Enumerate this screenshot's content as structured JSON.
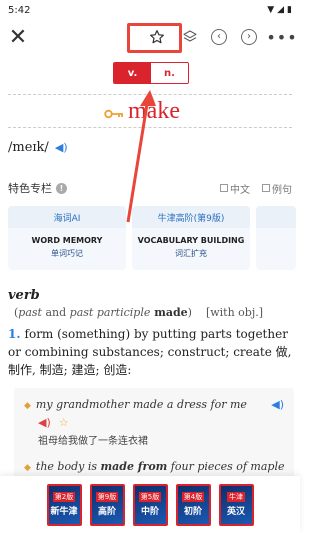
{
  "status_bar": {
    "time": "5:42"
  },
  "toolbar": {
    "close_glyph": "✕",
    "more_glyph": "•••"
  },
  "pos_tabs": [
    "v.",
    "n."
  ],
  "entry": {
    "headword": "make",
    "phonetic": "/meɪk/"
  },
  "features": {
    "title": "特色专栏",
    "toggle_chinese": "中文",
    "toggle_example": "例句",
    "cards": [
      {
        "top": "海词AI",
        "title": "WORD MEMORY",
        "sub": "单词巧记"
      },
      {
        "top": "牛津高阶(第9版)",
        "title": "VOCABULARY BUILDING",
        "sub": "词汇扩充"
      },
      {
        "top": "",
        "title": "",
        "sub": ""
      }
    ]
  },
  "definition": {
    "pos": "verb",
    "grammar_prefix": "(",
    "grammar_italic": "past",
    "grammar_mid": " and ",
    "grammar_italic2": "past participle",
    "grammar_bold": " made",
    "grammar_suffix": ")    [with obj.]",
    "sense_number": "1.",
    "sense_text": "form (something) by putting parts together or combining substances; construct; create 做, 制作, 制造; 建造; 创造:"
  },
  "examples": [
    {
      "text": "my grandmother made a dress for me",
      "translation": "祖母给我做了一条连衣裙"
    },
    {
      "text_prefix": "the body is ",
      "text_bold": "made from",
      "text_suffix": " four pieces of maple"
    }
  ],
  "books": [
    {
      "top": "第2版",
      "main": "新牛津"
    },
    {
      "top": "第9版",
      "main": "高阶"
    },
    {
      "top": "第5版",
      "main": "中阶"
    },
    {
      "top": "第4版",
      "main": "初阶"
    },
    {
      "top": "牛津",
      "main": "英汉"
    }
  ],
  "colors": {
    "accent": "#d9232d",
    "link": "#2a7de1",
    "annotation": "#e8463a"
  },
  "icons": [
    "close-icon",
    "star-icon",
    "layers-icon",
    "chevron-left-icon",
    "chevron-right-icon",
    "more-icon",
    "key-icon",
    "speaker-icon",
    "info-icon"
  ]
}
